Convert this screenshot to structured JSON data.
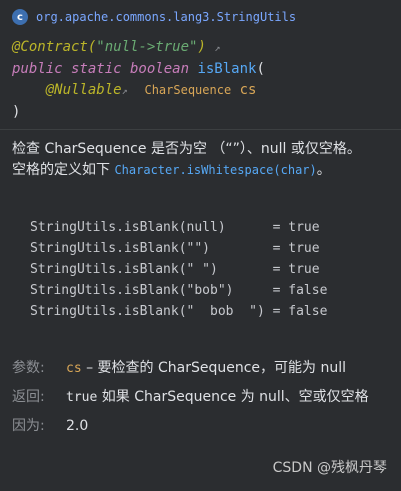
{
  "header": {
    "title": "org.apache.commons.lang3.StringUtils",
    "icon": "class-icon"
  },
  "signature": {
    "contract_annotation": "@Contract",
    "contract_open": "(",
    "contract_value": "\"null->true\"",
    "contract_close": ")",
    "line2_prefix": "public static boolean ",
    "method_name": "isBlank",
    "line2_paren": "(",
    "param_annotation": "@Nullable",
    "param_type": "CharSequence",
    "param_name": "cs",
    "closing_paren": ")"
  },
  "description": {
    "line1": "检查 CharSequence 是否为空 （“”）、null 或仅空格。",
    "line2_prefix": "空格的定义如下 ",
    "line2_code": "Character.isWhitespace(char)",
    "line2_suffix": "。"
  },
  "examples": [
    "StringUtils.isBlank(null)      = true",
    "StringUtils.isBlank(\"\")        = true",
    "StringUtils.isBlank(\" \")       = true",
    "StringUtils.isBlank(\"bob\")     = false",
    "StringUtils.isBlank(\"  bob  \") = false"
  ],
  "params": {
    "params_label": "参数:",
    "params_name": "cs",
    "params_text": " – 要检查的 CharSequence，可能为 null",
    "returns_label": "返回:",
    "returns_code": "true",
    "returns_text": " 如果 CharSequence 为 null、空或仅空格",
    "since_label": "因为:",
    "since_value": "2.0"
  },
  "watermark": "CSDN @残枫丹琴",
  "colors": {
    "background": "#2b2d30",
    "annotation": "#bbb529",
    "keyword": "#c77dba",
    "method": "#56a8f5",
    "string": "#6aab73",
    "param": "#d8a657"
  }
}
